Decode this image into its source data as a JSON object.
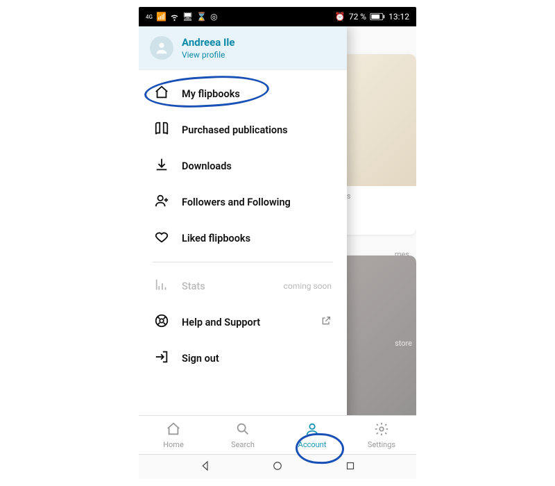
{
  "statusbar": {
    "network_badge": "4G",
    "battery_text": "72 %",
    "time": "13:12"
  },
  "profile": {
    "name": "Andreea Ile",
    "view_label": "View profile"
  },
  "menu": {
    "items": [
      {
        "label": "My flipbooks"
      },
      {
        "label": "Purchased publications"
      },
      {
        "label": "Downloads"
      },
      {
        "label": "Followers and Following"
      },
      {
        "label": "Liked flipbooks"
      }
    ],
    "stats": {
      "label": "Stats",
      "note": "coming soon"
    },
    "help": {
      "label": "Help and Support"
    },
    "signout": {
      "label": "Sign out"
    }
  },
  "background": {
    "card1_text": "nes",
    "card1_subtext": "mes",
    "card2_text": "store"
  },
  "tabs": {
    "home": "Home",
    "search": "Search",
    "account": "Account",
    "settings": "Settings"
  }
}
